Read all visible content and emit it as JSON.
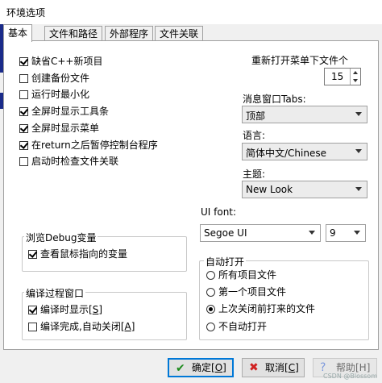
{
  "window": {
    "title": "环境选项"
  },
  "tabs": [
    {
      "label": "基本",
      "active": true
    },
    {
      "label": "文件和路径",
      "active": false
    },
    {
      "label": "外部程序",
      "active": false
    },
    {
      "label": "文件关联",
      "active": false
    }
  ],
  "options": [
    {
      "label": "缺省C++新项目",
      "checked": true
    },
    {
      "label": "创建备份文件",
      "checked": false
    },
    {
      "label": "运行时最小化",
      "checked": false
    },
    {
      "label": "全屏时显示工具条",
      "checked": true
    },
    {
      "label": "全屏时显示菜单",
      "checked": true
    },
    {
      "label": "在return之后暂停控制台程序",
      "checked": true
    },
    {
      "label": "启动时检查文件关联",
      "checked": false
    }
  ],
  "reopen": {
    "label": "重新打开菜单下文件个",
    "value": "15"
  },
  "msg_tabs": {
    "label": "消息窗口Tabs:",
    "value": "顶部"
  },
  "language": {
    "label": "语言:",
    "value": "简体中文/Chinese"
  },
  "theme": {
    "label": "主题:",
    "value": "New Look"
  },
  "ui_font": {
    "label": "UI font:",
    "font": "Segoe UI",
    "size": "9"
  },
  "debug_group": {
    "title": "浏览Debug变量",
    "items": [
      {
        "label": "查看鼠标指向的变量",
        "checked": true
      }
    ]
  },
  "compile_group": {
    "title": "编译过程窗口",
    "items": [
      {
        "label": "编译时显示",
        "hotkey": "S",
        "checked": true
      },
      {
        "label": "编译完成,自动关闭",
        "hotkey": "A",
        "checked": false
      }
    ]
  },
  "autoopen_group": {
    "title": "自动打开",
    "items": [
      {
        "label": "所有项目文件",
        "selected": false
      },
      {
        "label": "第一个项目文件",
        "selected": false
      },
      {
        "label": "上次关闭前打来的文件",
        "selected": true
      },
      {
        "label": "不自动打开",
        "selected": false
      }
    ]
  },
  "buttons": {
    "ok": {
      "label": "确定",
      "hotkey": "O"
    },
    "cancel": {
      "label": "取消",
      "hotkey": "C"
    },
    "help": {
      "label": "帮助[H]"
    }
  },
  "watermark": "CSDN @Blossom"
}
